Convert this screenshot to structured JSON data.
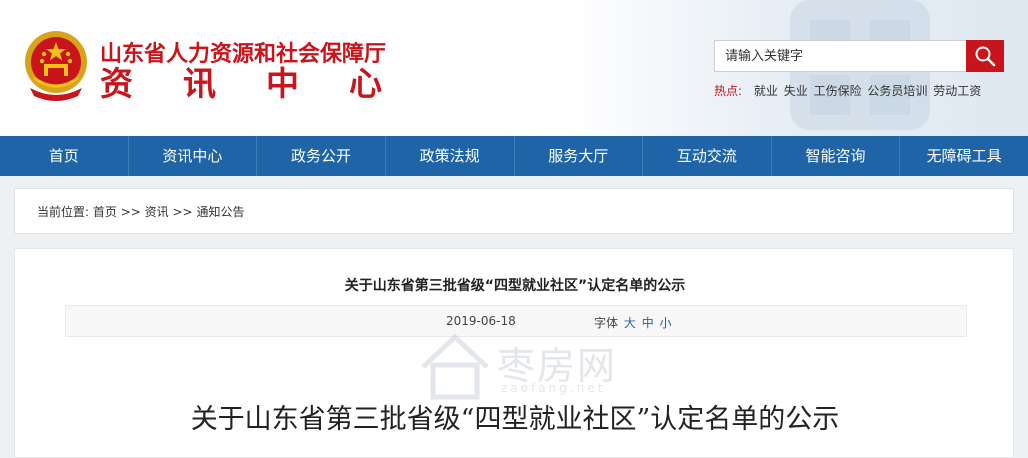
{
  "header": {
    "site_title": "山东省人力资源和社会保障厅",
    "site_sub_chars": [
      "资",
      "讯",
      "中",
      "心"
    ]
  },
  "search": {
    "placeholder": "请输入关键字"
  },
  "hot": {
    "label": "热点:",
    "links": [
      "就业",
      "失业",
      "工伤保险",
      "公务员培训",
      "劳动工资"
    ]
  },
  "nav": {
    "items": [
      "首页",
      "资讯中心",
      "政务公开",
      "政策法规",
      "服务大厅",
      "互动交流",
      "智能咨询",
      "无障碍工具"
    ]
  },
  "breadcrumb": {
    "prefix": "当前位置:",
    "home": "首页",
    "sep1": ">>",
    "section": "资讯",
    "sep2": ">>",
    "current": "通知公告"
  },
  "article": {
    "title": "关于山东省第三批省级“四型就业社区”认定名单的公示",
    "date": "2019-06-18",
    "font_label": "字体",
    "font_sizes": [
      "大",
      "中",
      "小"
    ],
    "big_title": "关于山东省第三批省级“四型就业社区”认定名单的公示"
  },
  "watermark": {
    "text": "枣房网",
    "url": "zaofang.net"
  },
  "colors": {
    "brand_red": "#c8141b",
    "nav_blue": "#1f64a6"
  }
}
